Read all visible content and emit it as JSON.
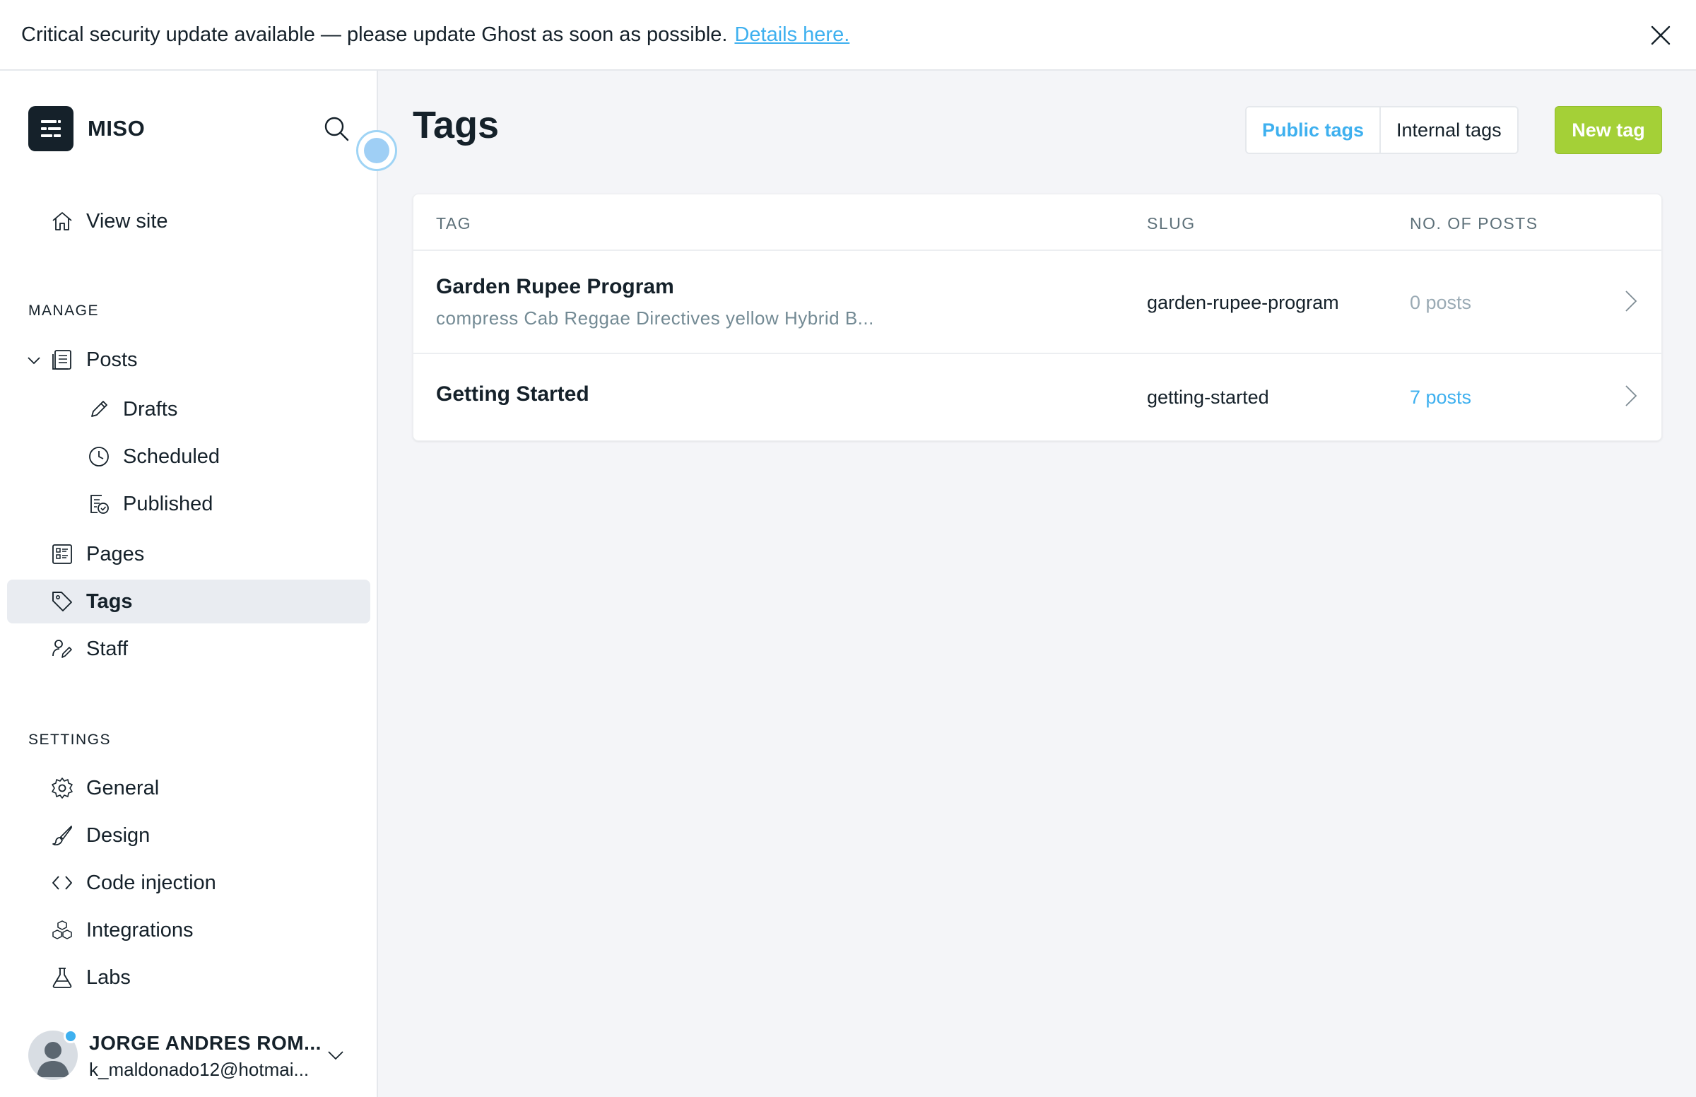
{
  "banner": {
    "message": "Critical security update available — please update Ghost as soon as possible.",
    "link": "Details here."
  },
  "sidebar": {
    "brand": "MISO",
    "view_site": "View site",
    "manage_heading": "MANAGE",
    "items": {
      "posts": "Posts",
      "drafts": "Drafts",
      "scheduled": "Scheduled",
      "published": "Published",
      "pages": "Pages",
      "tags": "Tags",
      "staff": "Staff"
    },
    "settings_heading": "SETTINGS",
    "settings": {
      "general": "General",
      "design": "Design",
      "code_injection": "Code injection",
      "integrations": "Integrations",
      "labs": "Labs"
    },
    "user": {
      "name": "JORGE ANDRES ROM...",
      "email": "k_maldonado12@hotmai..."
    }
  },
  "main": {
    "title": "Tags",
    "filters": [
      "Public tags",
      "Internal tags"
    ],
    "new_button": "New tag",
    "columns": [
      "TAG",
      "SLUG",
      "NO. OF POSTS"
    ],
    "rows": [
      {
        "name": "Garden Rupee Program",
        "description": "compress Cab Reggae Directives yellow Hybrid B...",
        "slug": "garden-rupee-program",
        "posts": "0 posts"
      },
      {
        "name": "Getting Started",
        "description": "",
        "slug": "getting-started",
        "posts": "7 posts"
      }
    ]
  },
  "colors": {
    "accent": "#3eb0ef",
    "primary_button": "#a4d037",
    "text": "#15212a",
    "muted": "#738a94"
  }
}
